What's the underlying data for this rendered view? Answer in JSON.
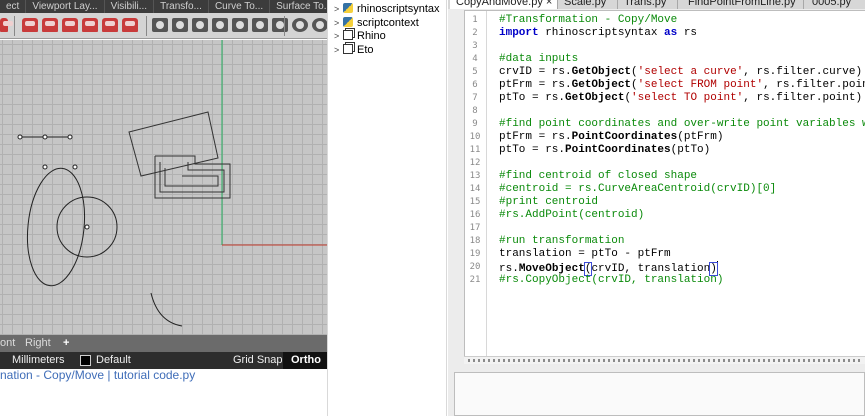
{
  "rhino": {
    "toolbar_tabs": [
      "ect",
      "Viewport Lay...",
      "Visibili...",
      "Transfo...",
      "Curve To...",
      "Surface To..."
    ],
    "viewport_tabs": {
      "partial": "ont",
      "right": "Right",
      "add": "+"
    },
    "status": {
      "units": "Millimeters",
      "layer": "Default",
      "grid_snap": "Grid Snap",
      "ortho": "Ortho"
    },
    "caption": "nation - Copy/Move | tutorial code.py",
    "colors": {
      "grid_bg": "#c6c6c6",
      "x_axis": "#c0392b",
      "y_axis": "#27ae60",
      "curve": "#222222"
    }
  },
  "tree": {
    "items": [
      {
        "label": "rhinoscriptsyntax",
        "icon": "python-icon"
      },
      {
        "label": "scriptcontext",
        "icon": "python-icon"
      },
      {
        "label": "Rhino",
        "icon": "assembly-icon"
      },
      {
        "label": "Eto",
        "icon": "assembly-icon"
      }
    ]
  },
  "editor": {
    "tabs": [
      {
        "label": "CopyAndMove.py",
        "active": true,
        "closable": true
      },
      {
        "label": "Scale.py",
        "active": false
      },
      {
        "label": "Trans.py",
        "active": false
      },
      {
        "label": "FindPointFromLine.py",
        "active": false
      },
      {
        "label": "0005.py",
        "active": false
      }
    ],
    "line_numbers": [
      "1",
      "2",
      "3",
      "4",
      "5",
      "6",
      "7",
      "8",
      "9",
      "10",
      "11",
      "12",
      "13",
      "14",
      "15",
      "16",
      "17",
      "18",
      "19",
      "20",
      "21"
    ],
    "code": {
      "l1": "#Transformation - Copy/Move",
      "l2_kw1": "import",
      "l2_mod": " rhinoscriptsyntax ",
      "l2_kw2": "as",
      "l2_alias": " rs",
      "l4": "#data inputs",
      "l5_a": "crvID = rs.",
      "l5_fn": "GetObject",
      "l5_b": "(",
      "l5_str": "'select a curve'",
      "l5_c": ", rs.filter.curve)",
      "l6_a": "ptFrm = rs.",
      "l6_fn": "GetObject",
      "l6_b": "(",
      "l6_str": "'select FROM point'",
      "l6_c": ", rs.filter.point)",
      "l7_a": "ptTo = rs.",
      "l7_fn": "GetObject",
      "l7_b": "(",
      "l7_str": "'select TO point'",
      "l7_c": ", rs.filter.point)",
      "l9": "#find point coordinates and over-write point variables with",
      "l10_a": "ptFrm = rs.",
      "l10_fn": "PointCoordinates",
      "l10_b": "(ptFrm)",
      "l11_a": "ptTo = rs.",
      "l11_fn": "PointCoordinates",
      "l11_b": "(ptTo)",
      "l13": "#find centroid of closed shape",
      "l14": "#centroid = rs.CurveAreaCentroid(crvID)[0]",
      "l15": "#print centroid",
      "l16": "#rs.AddPoint(centroid)",
      "l18": "#run transformation",
      "l19": "translation = ptTo - ptFrm",
      "l20_a": "rs.",
      "l20_fn": "MoveObject",
      "l20_open": "(",
      "l20_b": "crvID, translation",
      "l20_close": ")",
      "l21": "#rs.CopyObject(crvID, translation)"
    }
  }
}
